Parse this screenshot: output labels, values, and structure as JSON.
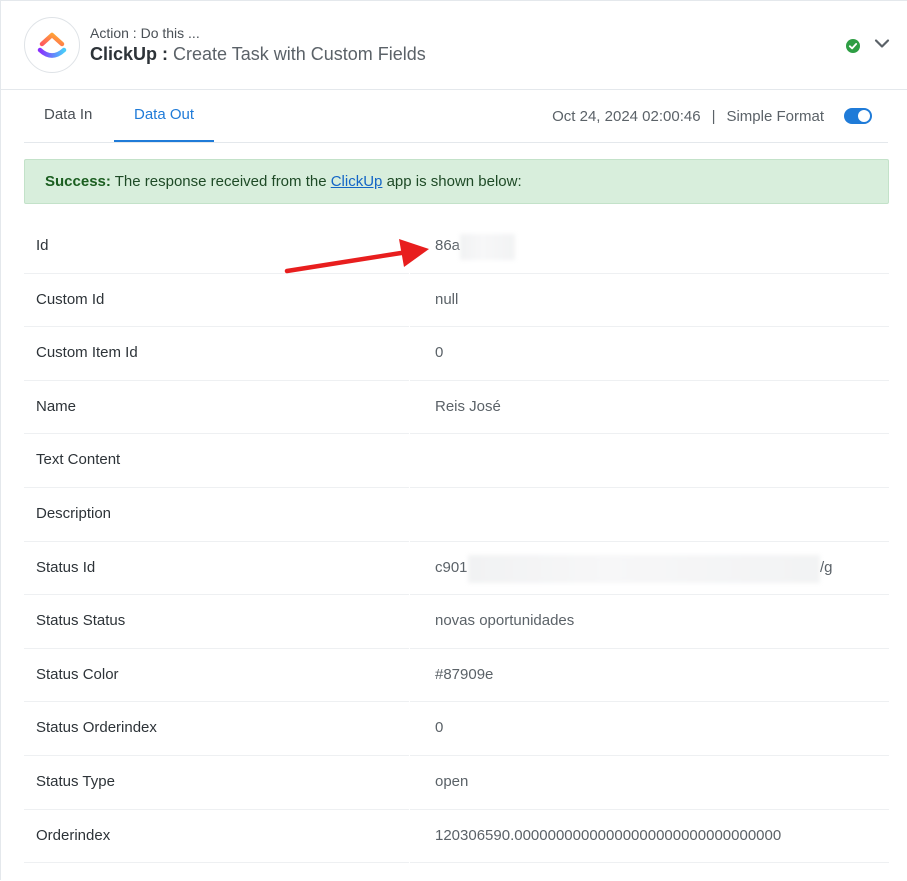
{
  "header": {
    "subtitle": "Action : Do this ...",
    "app_name": "ClickUp :",
    "action_title": "Create Task with Custom Fields"
  },
  "tabs": [
    {
      "label": "Data In",
      "active": false
    },
    {
      "label": "Data Out",
      "active": true
    }
  ],
  "meta": {
    "timestamp": "Oct 24, 2024 02:00:46",
    "separator": "|",
    "format_label": "Simple Format",
    "simple_format_on": true
  },
  "alert": {
    "strong": "Success:",
    "text_before": " The response received from the ",
    "link": "ClickUp",
    "text_after": " app is shown below:"
  },
  "rows": [
    {
      "key": "Id",
      "value": "86a"
    },
    {
      "key": "Custom Id",
      "value": "null"
    },
    {
      "key": "Custom Item Id",
      "value": "0"
    },
    {
      "key": "Name",
      "value": "Reis José"
    },
    {
      "key": "Text Content",
      "value": ""
    },
    {
      "key": "Description",
      "value": ""
    },
    {
      "key": "Status Id",
      "value": "c901",
      "value_suffix": "/g"
    },
    {
      "key": "Status Status",
      "value": "novas oportunidades"
    },
    {
      "key": "Status Color",
      "value": "#87909e"
    },
    {
      "key": "Status Orderindex",
      "value": "0"
    },
    {
      "key": "Status Type",
      "value": "open"
    },
    {
      "key": "Orderindex",
      "value": "120306590.00000000000000000000000000000000"
    }
  ],
  "colors": {
    "accent": "#1f7bd8",
    "success_bg": "#d8eedc",
    "check": "#2e9e44",
    "arrow": "#e81e1e"
  },
  "icons": {
    "logo": "clickup-logo",
    "status": "check-circle-icon",
    "collapse": "chevron-down-icon"
  }
}
